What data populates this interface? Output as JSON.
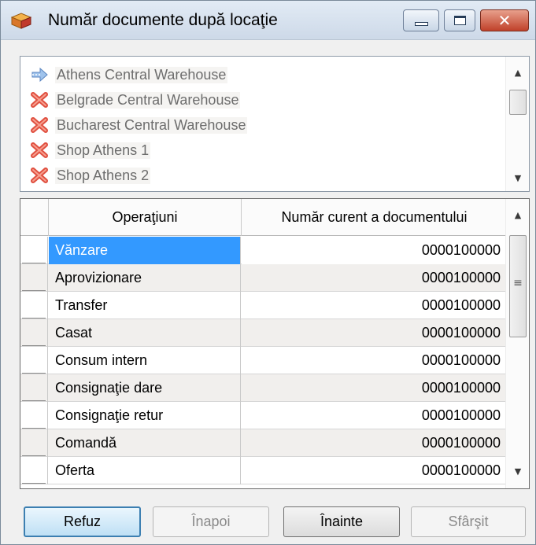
{
  "window": {
    "title": "Număr documente după locaţie",
    "buttons": {
      "minimize": "minimize-icon",
      "maximize": "maximize-icon",
      "close": "close-icon",
      "close_glyph": "✕"
    }
  },
  "locations": {
    "items": [
      {
        "label": "Athens Central Warehouse",
        "icon": "arrow-right-icon"
      },
      {
        "label": "Belgrade Central Warehouse",
        "icon": "red-x-icon"
      },
      {
        "label": "Bucharest Central Warehouse",
        "icon": "red-x-icon"
      },
      {
        "label": "Shop Athens 1",
        "icon": "red-x-icon"
      },
      {
        "label": "Shop Athens 2",
        "icon": "red-x-icon"
      }
    ],
    "scroll_up": "▲",
    "scroll_down": "▼"
  },
  "grid": {
    "columns": [
      "Operaţiuni",
      "Număr curent a documentului"
    ],
    "rows": [
      {
        "operation": "Vănzare",
        "number": "0000100000"
      },
      {
        "operation": "Aprovizionare",
        "number": "0000100000"
      },
      {
        "operation": "Transfer",
        "number": "0000100000"
      },
      {
        "operation": "Casat",
        "number": "0000100000"
      },
      {
        "operation": "Consum intern",
        "number": "0000100000"
      },
      {
        "operation": "Consignaţie dare",
        "number": "0000100000"
      },
      {
        "operation": "Consignaţie retur",
        "number": "0000100000"
      },
      {
        "operation": "Comandă",
        "number": "0000100000"
      },
      {
        "operation": "Oferta",
        "number": "0000100000"
      }
    ],
    "scroll_up": "▲",
    "scroll_down": "▼",
    "scroll_grip": "≡"
  },
  "buttons": {
    "refuse": "Refuz",
    "back": "Înapoi",
    "next": "Înainte",
    "finish": "Sfârşit"
  },
  "colors": {
    "selection": "#3399ff",
    "row_alt": "#f1efed",
    "default_button_border": "#3c7fb1"
  }
}
